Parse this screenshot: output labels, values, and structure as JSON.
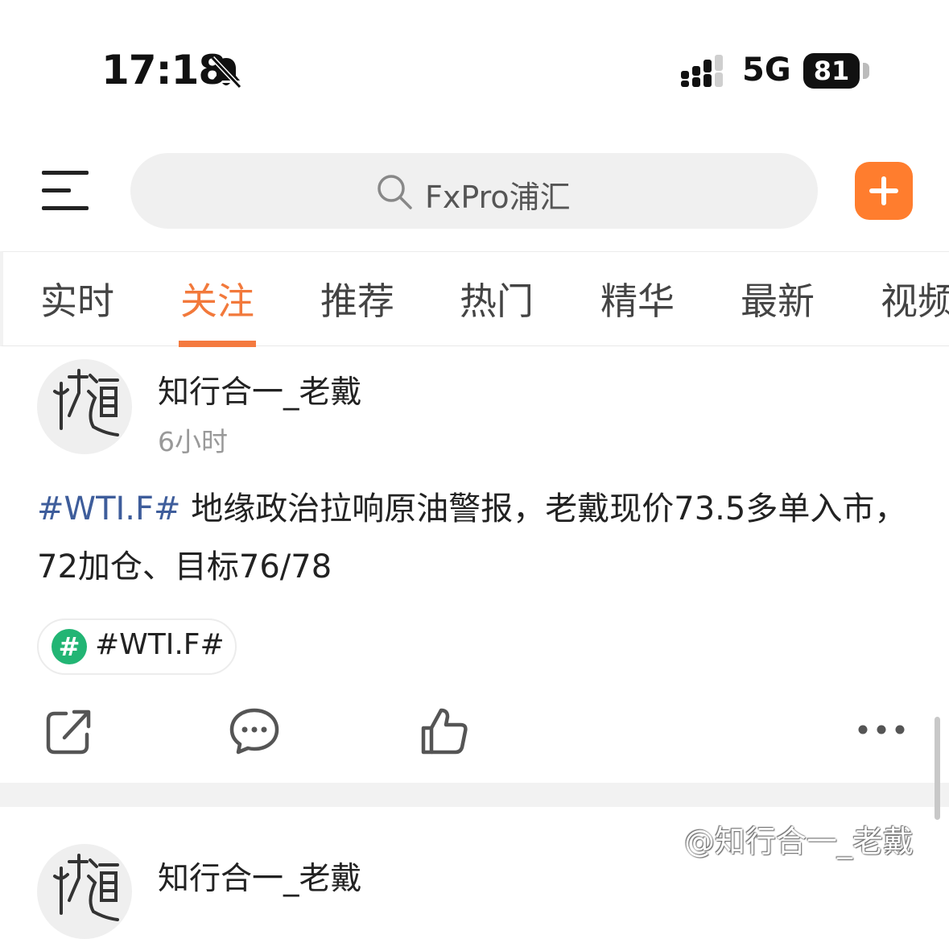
{
  "status_bar": {
    "time": "17:18",
    "network": "5G",
    "battery": "81",
    "icons": [
      "bell-slash-icon",
      "signal-icon"
    ]
  },
  "top_bar": {
    "search_placeholder": "FxPro浦汇",
    "icons": [
      "menu-icon",
      "search-icon",
      "plus-icon"
    ],
    "accent_color": "#ff7d2e"
  },
  "tabs": [
    {
      "label": "实时",
      "active": false
    },
    {
      "label": "关注",
      "active": true
    },
    {
      "label": "推荐",
      "active": false
    },
    {
      "label": "热门",
      "active": false
    },
    {
      "label": "精华",
      "active": false
    },
    {
      "label": "最新",
      "active": false
    },
    {
      "label": "视频",
      "active": false
    }
  ],
  "posts": [
    {
      "author": "知行合一_老戴",
      "time_ago": "6小时",
      "hashtag": "#WTI.F#",
      "text": " 地缘政治拉响原油警报，老戴现价73.5多单入市，72加仓、目标76/78",
      "topic_chip": "#WTI.F#",
      "topic_icon": "#",
      "actions": [
        "share-icon",
        "comment-icon",
        "like-icon",
        "more-icon"
      ]
    },
    {
      "author": "知行合一_老戴"
    }
  ],
  "watermark": "@知行合一_老戴",
  "colors": {
    "active_tab": "#f2793b",
    "hashtag": "#3e5d9b",
    "topic_icon_bg": "#22b574"
  }
}
